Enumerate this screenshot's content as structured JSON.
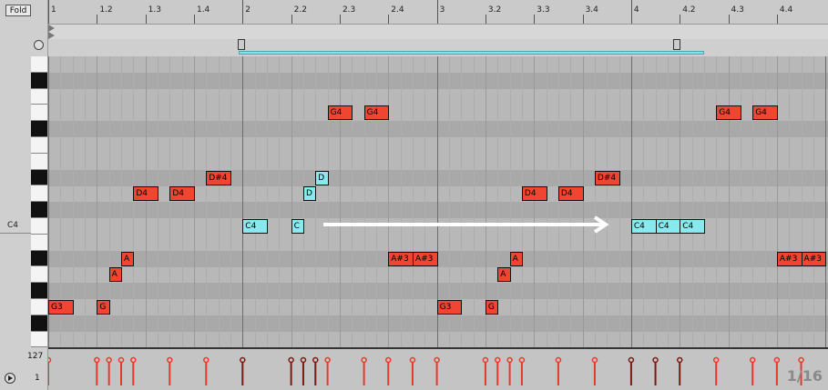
{
  "header": {
    "fold_label": "Fold"
  },
  "ruler": {
    "labels": [
      {
        "text": "1",
        "beat": 1.0
      },
      {
        "text": "1.2",
        "beat": 1.25
      },
      {
        "text": "1.3",
        "beat": 1.5
      },
      {
        "text": "1.4",
        "beat": 1.75
      },
      {
        "text": "2",
        "beat": 2.0
      },
      {
        "text": "2.2",
        "beat": 2.25
      },
      {
        "text": "2.3",
        "beat": 2.5
      },
      {
        "text": "2.4",
        "beat": 2.75
      },
      {
        "text": "3",
        "beat": 3.0
      },
      {
        "text": "3.2",
        "beat": 3.25
      },
      {
        "text": "3.3",
        "beat": 3.5
      },
      {
        "text": "3.4",
        "beat": 3.75
      },
      {
        "text": "4",
        "beat": 4.0
      },
      {
        "text": "4.2",
        "beat": 4.25
      },
      {
        "text": "4.3",
        "beat": 4.5
      },
      {
        "text": "4.4",
        "beat": 4.75
      }
    ]
  },
  "keyboard": {
    "c4_label": "C4"
  },
  "velocity": {
    "max_label": "127",
    "min_label": "1"
  },
  "grid_resolution": "1/16",
  "colors": {
    "note_red": "#f04530",
    "note_cyan": "#8ae9ee",
    "arrow": "#ffffff"
  },
  "notes": [
    {
      "label": "G3",
      "pitch": "G3",
      "start": 1.0,
      "len": 0.125,
      "color": "red"
    },
    {
      "label": "G",
      "pitch": "G3",
      "start": 1.25,
      "len": 0.0625,
      "color": "red"
    },
    {
      "label": "A",
      "pitch": "A3",
      "start": 1.3125,
      "len": 0.0625,
      "color": "red"
    },
    {
      "label": "A",
      "pitch": "A#3",
      "start": 1.375,
      "len": 0.0625,
      "color": "red"
    },
    {
      "label": "D4",
      "pitch": "D4",
      "start": 1.4375,
      "len": 0.125,
      "color": "red"
    },
    {
      "label": "D4",
      "pitch": "D4",
      "start": 1.625,
      "len": 0.125,
      "color": "red"
    },
    {
      "label": "D#4",
      "pitch": "D#4",
      "start": 1.8125,
      "len": 0.125,
      "color": "red"
    },
    {
      "label": "C4",
      "pitch": "C4",
      "start": 2.0,
      "len": 0.125,
      "color": "cyan"
    },
    {
      "label": "C",
      "pitch": "C4",
      "start": 2.25,
      "len": 0.0625,
      "color": "cyan"
    },
    {
      "label": "D",
      "pitch": "D4",
      "start": 2.3125,
      "len": 0.0625,
      "color": "cyan"
    },
    {
      "label": "D",
      "pitch": "D#4",
      "start": 2.375,
      "len": 0.0625,
      "color": "cyan"
    },
    {
      "label": "G4",
      "pitch": "G4",
      "start": 2.4375,
      "len": 0.125,
      "color": "red"
    },
    {
      "label": "G4",
      "pitch": "G4",
      "start": 2.625,
      "len": 0.125,
      "color": "red"
    },
    {
      "label": "A#3",
      "pitch": "A#3",
      "start": 2.75,
      "len": 0.125,
      "color": "red"
    },
    {
      "label": "A#3",
      "pitch": "A#3",
      "start": 2.875,
      "len": 0.125,
      "color": "red"
    },
    {
      "label": "G3",
      "pitch": "G3",
      "start": 3.0,
      "len": 0.125,
      "color": "red"
    },
    {
      "label": "G",
      "pitch": "G3",
      "start": 3.25,
      "len": 0.0625,
      "color": "red"
    },
    {
      "label": "A",
      "pitch": "A3",
      "start": 3.3125,
      "len": 0.0625,
      "color": "red"
    },
    {
      "label": "A",
      "pitch": "A#3",
      "start": 3.375,
      "len": 0.0625,
      "color": "red"
    },
    {
      "label": "D4",
      "pitch": "D4",
      "start": 3.4375,
      "len": 0.125,
      "color": "red"
    },
    {
      "label": "D4",
      "pitch": "D4",
      "start": 3.625,
      "len": 0.125,
      "color": "red"
    },
    {
      "label": "D#4",
      "pitch": "D#4",
      "start": 3.8125,
      "len": 0.125,
      "color": "red"
    },
    {
      "label": "C4",
      "pitch": "C4",
      "start": 4.0,
      "len": 0.125,
      "color": "cyan"
    },
    {
      "label": "C4",
      "pitch": "C4",
      "start": 4.125,
      "len": 0.125,
      "color": "cyan"
    },
    {
      "label": "C4",
      "pitch": "C4",
      "start": 4.25,
      "len": 0.125,
      "color": "cyan"
    },
    {
      "label": "G4",
      "pitch": "G4",
      "start": 4.4375,
      "len": 0.125,
      "color": "red"
    },
    {
      "label": "G4",
      "pitch": "G4",
      "start": 4.625,
      "len": 0.125,
      "color": "red"
    },
    {
      "label": "A#3",
      "pitch": "A#3",
      "start": 4.75,
      "len": 0.125,
      "color": "red"
    },
    {
      "label": "A#3",
      "pitch": "A#3",
      "start": 4.875,
      "len": 0.125,
      "color": "red"
    }
  ],
  "velocity_stems": [
    {
      "beat": 1.0,
      "c": "red"
    },
    {
      "beat": 1.25,
      "c": "red"
    },
    {
      "beat": 1.3125,
      "c": "red"
    },
    {
      "beat": 1.375,
      "c": "red"
    },
    {
      "beat": 1.4375,
      "c": "red"
    },
    {
      "beat": 1.625,
      "c": "red"
    },
    {
      "beat": 1.8125,
      "c": "red"
    },
    {
      "beat": 2.0,
      "c": "dark"
    },
    {
      "beat": 2.25,
      "c": "dark"
    },
    {
      "beat": 2.3125,
      "c": "dark"
    },
    {
      "beat": 2.375,
      "c": "dark"
    },
    {
      "beat": 2.4375,
      "c": "red"
    },
    {
      "beat": 2.625,
      "c": "red"
    },
    {
      "beat": 2.75,
      "c": "red"
    },
    {
      "beat": 2.875,
      "c": "red"
    },
    {
      "beat": 3.0,
      "c": "red"
    },
    {
      "beat": 3.25,
      "c": "red"
    },
    {
      "beat": 3.3125,
      "c": "red"
    },
    {
      "beat": 3.375,
      "c": "red"
    },
    {
      "beat": 3.4375,
      "c": "red"
    },
    {
      "beat": 3.625,
      "c": "red"
    },
    {
      "beat": 3.8125,
      "c": "red"
    },
    {
      "beat": 4.0,
      "c": "dark"
    },
    {
      "beat": 4.125,
      "c": "dark"
    },
    {
      "beat": 4.25,
      "c": "dark"
    },
    {
      "beat": 4.4375,
      "c": "red"
    },
    {
      "beat": 4.625,
      "c": "red"
    },
    {
      "beat": 4.75,
      "c": "red"
    },
    {
      "beat": 4.875,
      "c": "red"
    }
  ]
}
